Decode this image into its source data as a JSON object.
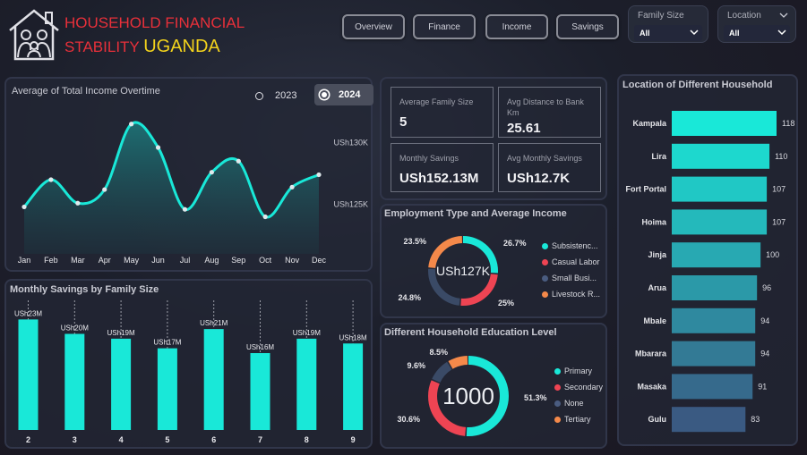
{
  "header": {
    "title_line1": "HOUSEHOLD FINANCIAL",
    "title_line2": "STABILITY",
    "title_highlight": "UGANDA"
  },
  "nav": [
    {
      "label": "Overview"
    },
    {
      "label": "Finance"
    },
    {
      "label": "Income"
    },
    {
      "label": "Savings"
    }
  ],
  "filters": {
    "family_size": {
      "label": "Family Size",
      "value": "All"
    },
    "location": {
      "label": "Location",
      "value": "All"
    }
  },
  "income_panel": {
    "title": "Average of Total Income Overtime",
    "year_options": [
      {
        "label": "2023",
        "selected": false
      },
      {
        "label": "2024",
        "selected": true
      }
    ]
  },
  "kpis": [
    {
      "label": "Average Family Size",
      "value": "5"
    },
    {
      "label": "Avg Distance to Bank Km",
      "value": "25.61"
    },
    {
      "label": "Monthly Savings",
      "value": "USh152.13M"
    },
    {
      "label": "Avg Monthly Savings",
      "value": "USh12.7K"
    }
  ],
  "colors": {
    "cyan": "#19e8d8",
    "red": "#ee4453",
    "navy": "#3a4a66",
    "orange": "#f4894a",
    "title_red": "#e8303a",
    "title_yellow": "#f2d21c"
  },
  "chart_data": [
    {
      "id": "income_line",
      "type": "area",
      "title": "Average of Total Income Overtime",
      "categories": [
        "Jan",
        "Feb",
        "Mar",
        "Apr",
        "May",
        "Jun",
        "Jul",
        "Aug",
        "Sep",
        "Oct",
        "Nov",
        "Dec"
      ],
      "values": [
        124.8,
        127.0,
        125.1,
        126.2,
        131.5,
        129.6,
        124.6,
        127.6,
        128.5,
        124.0,
        126.4,
        127.4
      ],
      "ytick_labels": [
        "USh125K",
        "USh130K"
      ],
      "yticks": [
        125,
        130
      ],
      "ylim": [
        121,
        133
      ]
    },
    {
      "id": "savings_by_family",
      "type": "bar",
      "title": "Monthly Savings by Family Size",
      "categories": [
        "2",
        "3",
        "4",
        "5",
        "6",
        "7",
        "8",
        "9"
      ],
      "values": [
        23,
        20,
        19,
        17,
        21,
        16,
        19,
        18
      ],
      "data_labels": [
        "USh23M",
        "USh20M",
        "USh19M",
        "USh17M",
        "USh21M",
        "USh16M",
        "USh19M",
        "USh18M"
      ],
      "ylim": [
        0,
        24
      ]
    },
    {
      "id": "employment_donut",
      "type": "pie",
      "title": "Employment Type and Average Income",
      "center_label": "USh127K",
      "labels": [
        "Subsistenc...",
        "Casual Labor",
        "Small Busi...",
        "Livestock R..."
      ],
      "values": [
        26.7,
        25,
        24.8,
        23.5
      ],
      "value_labels": [
        "26.7%",
        "25%",
        "24.8%",
        "23.5%"
      ],
      "colors": [
        "#19e8d8",
        "#ee4453",
        "#3a4a66",
        "#f4894a"
      ]
    },
    {
      "id": "education_donut",
      "type": "pie",
      "title": "Different Household Education Level",
      "center_label": "1000",
      "labels": [
        "Primary",
        "Secondary",
        "None",
        "Tertiary"
      ],
      "values": [
        51.3,
        30.6,
        9.6,
        8.5
      ],
      "value_labels": [
        "51.3%",
        "30.6%",
        "9.6%",
        "8.5%"
      ],
      "colors": [
        "#19e8d8",
        "#ee4453",
        "#3a4a66",
        "#f4894a"
      ]
    },
    {
      "id": "location_bars",
      "type": "bar",
      "orientation": "horizontal",
      "title": "Location of Different Household",
      "categories": [
        "Kampala",
        "Lira",
        "Fort Portal",
        "Hoima",
        "Jinja",
        "Arua",
        "Mbale",
        "Mbarara",
        "Masaka",
        "Gulu"
      ],
      "values": [
        118,
        110,
        107,
        107,
        100,
        96,
        94,
        94,
        91,
        83
      ],
      "xlim": [
        0,
        118
      ]
    }
  ]
}
